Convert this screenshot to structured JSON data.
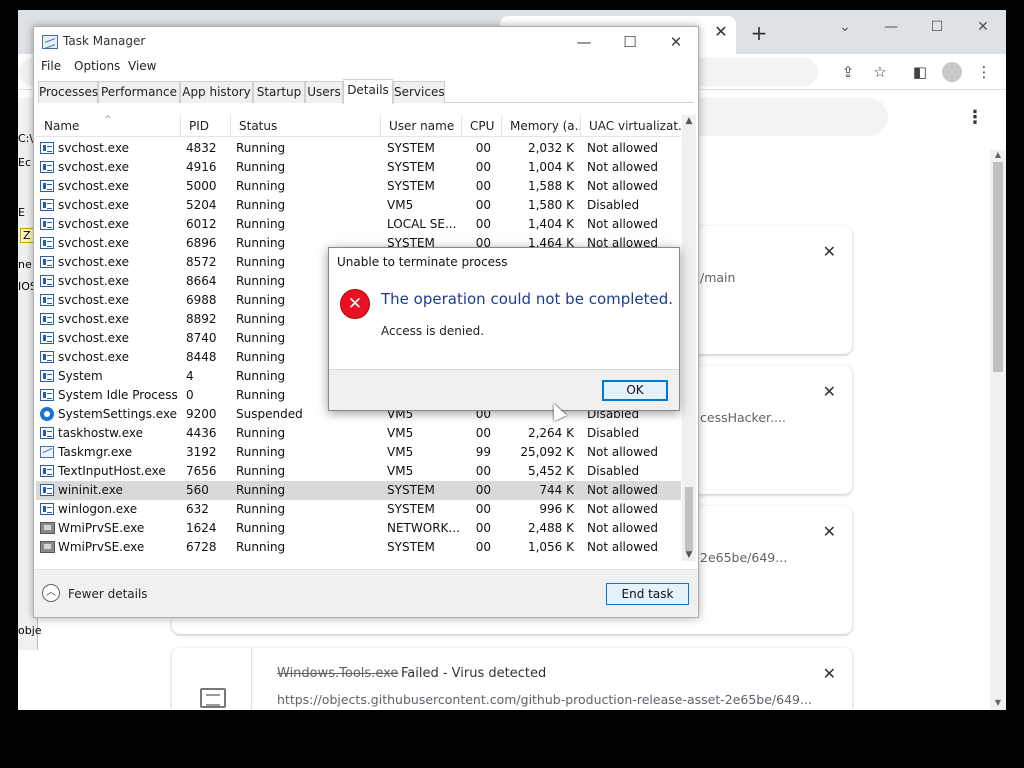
{
  "chrome": {
    "downloads": [
      {
        "url": "/main"
      },
      {
        "url": "cessHacker...."
      },
      {
        "url": "2e65be/649..."
      }
    ],
    "file_item": {
      "name": "Windows.Tools.exe",
      "status": "Failed - Virus detected",
      "url": "https://objects.githubusercontent.com/github-production-release-asset-2e65be/649..."
    },
    "close_glyph": "✕"
  },
  "cmd_fragments": [
    "C:\\",
    "Ec",
    "E",
    "Z",
    "ne",
    "IOS",
    "obje"
  ],
  "task_manager": {
    "title": "Task Manager",
    "menu": [
      "File",
      "Options",
      "View"
    ],
    "tabs": [
      "Processes",
      "Performance",
      "App history",
      "Startup",
      "Users",
      "Details",
      "Services"
    ],
    "active_tab": "Details",
    "columns": [
      "Name",
      "PID",
      "Status",
      "User name",
      "CPU",
      "Memory (a...",
      "UAC virtualizat..."
    ],
    "rows": [
      {
        "icon": "process",
        "name": "svchost.exe",
        "pid": "4832",
        "status": "Running",
        "user": "SYSTEM",
        "cpu": "00",
        "mem": "2,032 K",
        "uac": "Not allowed"
      },
      {
        "icon": "process",
        "name": "svchost.exe",
        "pid": "4916",
        "status": "Running",
        "user": "SYSTEM",
        "cpu": "00",
        "mem": "1,004 K",
        "uac": "Not allowed"
      },
      {
        "icon": "process",
        "name": "svchost.exe",
        "pid": "5000",
        "status": "Running",
        "user": "SYSTEM",
        "cpu": "00",
        "mem": "1,588 K",
        "uac": "Not allowed"
      },
      {
        "icon": "process",
        "name": "svchost.exe",
        "pid": "5204",
        "status": "Running",
        "user": "VM5",
        "cpu": "00",
        "mem": "1,580 K",
        "uac": "Disabled"
      },
      {
        "icon": "process",
        "name": "svchost.exe",
        "pid": "6012",
        "status": "Running",
        "user": "LOCAL SE...",
        "cpu": "00",
        "mem": "1,404 K",
        "uac": "Not allowed"
      },
      {
        "icon": "process",
        "name": "svchost.exe",
        "pid": "6896",
        "status": "Running",
        "user": "SYSTEM",
        "cpu": "00",
        "mem": "1,464 K",
        "uac": "Not allowed"
      },
      {
        "icon": "process",
        "name": "svchost.exe",
        "pid": "8572",
        "status": "Running",
        "user": "",
        "cpu": "",
        "mem": "",
        "uac": ""
      },
      {
        "icon": "process",
        "name": "svchost.exe",
        "pid": "8664",
        "status": "Running",
        "user": "",
        "cpu": "",
        "mem": "",
        "uac": ""
      },
      {
        "icon": "process",
        "name": "svchost.exe",
        "pid": "6988",
        "status": "Running",
        "user": "",
        "cpu": "",
        "mem": "",
        "uac": ""
      },
      {
        "icon": "process",
        "name": "svchost.exe",
        "pid": "8892",
        "status": "Running",
        "user": "",
        "cpu": "",
        "mem": "",
        "uac": ""
      },
      {
        "icon": "process",
        "name": "svchost.exe",
        "pid": "8740",
        "status": "Running",
        "user": "",
        "cpu": "",
        "mem": "",
        "uac": ""
      },
      {
        "icon": "process",
        "name": "svchost.exe",
        "pid": "8448",
        "status": "Running",
        "user": "",
        "cpu": "",
        "mem": "",
        "uac": ""
      },
      {
        "icon": "process",
        "name": "System",
        "pid": "4",
        "status": "Running",
        "user": "",
        "cpu": "",
        "mem": "",
        "uac": ""
      },
      {
        "icon": "process",
        "name": "System Idle Process",
        "pid": "0",
        "status": "Running",
        "user": "",
        "cpu": "",
        "mem": "",
        "uac": ""
      },
      {
        "icon": "gear",
        "name": "SystemSettings.exe",
        "pid": "9200",
        "status": "Suspended",
        "user": "VM5",
        "cpu": "00",
        "mem": "",
        "uac": "Disabled"
      },
      {
        "icon": "process",
        "name": "taskhostw.exe",
        "pid": "4436",
        "status": "Running",
        "user": "VM5",
        "cpu": "00",
        "mem": "2,264 K",
        "uac": "Disabled"
      },
      {
        "icon": "taskmgr",
        "name": "Taskmgr.exe",
        "pid": "3192",
        "status": "Running",
        "user": "VM5",
        "cpu": "99",
        "mem": "25,092 K",
        "uac": "Not allowed"
      },
      {
        "icon": "process",
        "name": "TextInputHost.exe",
        "pid": "7656",
        "status": "Running",
        "user": "VM5",
        "cpu": "00",
        "mem": "5,452 K",
        "uac": "Disabled"
      },
      {
        "icon": "process",
        "name": "wininit.exe",
        "pid": "560",
        "status": "Running",
        "user": "SYSTEM",
        "cpu": "00",
        "mem": "744 K",
        "uac": "Not allowed",
        "selected": true
      },
      {
        "icon": "process",
        "name": "winlogon.exe",
        "pid": "632",
        "status": "Running",
        "user": "SYSTEM",
        "cpu": "00",
        "mem": "996 K",
        "uac": "Not allowed"
      },
      {
        "icon": "wmi",
        "name": "WmiPrvSE.exe",
        "pid": "1624",
        "status": "Running",
        "user": "NETWORK...",
        "cpu": "00",
        "mem": "2,488 K",
        "uac": "Not allowed"
      },
      {
        "icon": "wmi",
        "name": "WmiPrvSE.exe",
        "pid": "6728",
        "status": "Running",
        "user": "SYSTEM",
        "cpu": "00",
        "mem": "1,056 K",
        "uac": "Not allowed"
      }
    ],
    "fewer_details": "Fewer details",
    "end_task": "End task"
  },
  "dialog": {
    "title": "Unable to terminate process",
    "message": "The operation could not be completed.",
    "detail": "Access is denied.",
    "ok": "OK",
    "icon_glyph": "✕"
  }
}
